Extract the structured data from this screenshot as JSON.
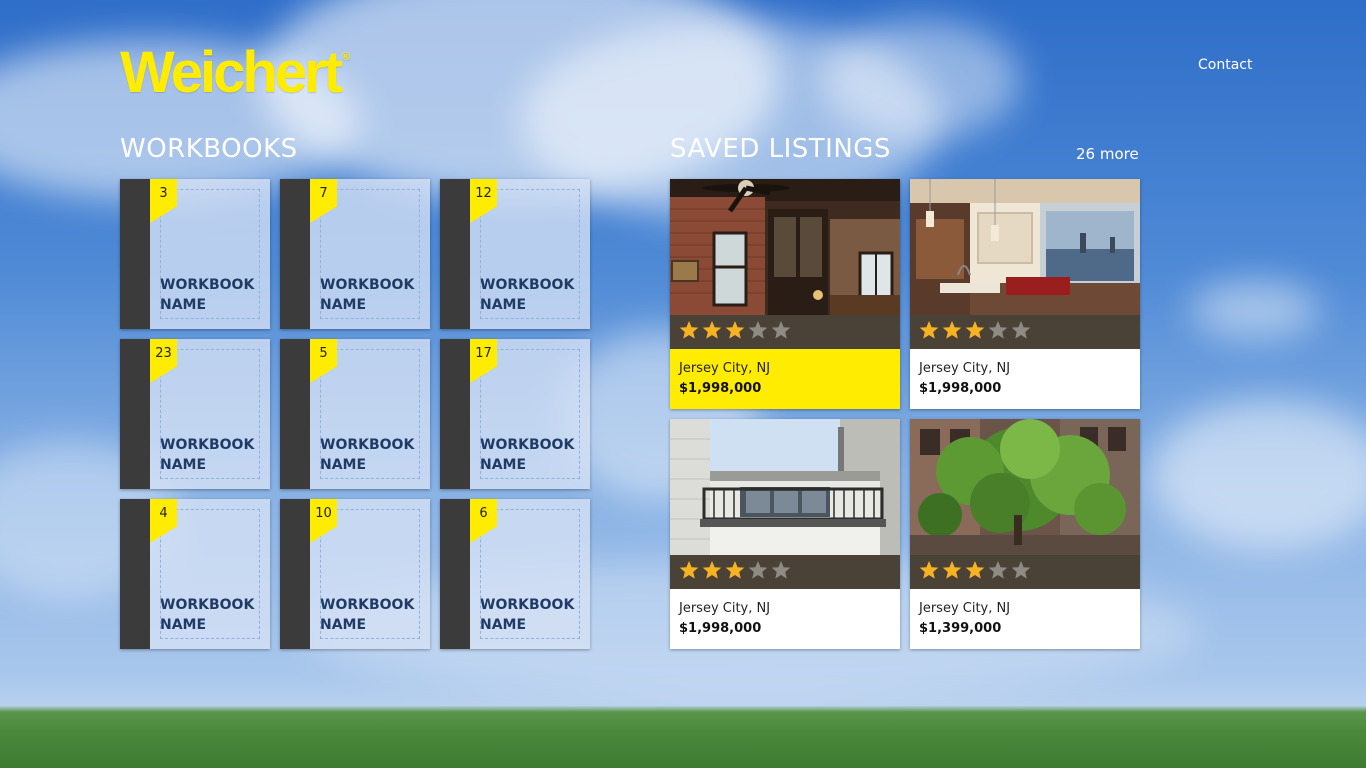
{
  "app": {
    "logo_text": "Weichert",
    "logo_mark": "®",
    "contact_label": "Contact"
  },
  "workbooks": {
    "title": "WORKBOOKS",
    "items": [
      {
        "count": "3",
        "name_line1": "WORKBOOK",
        "name_line2": "NAME"
      },
      {
        "count": "7",
        "name_line1": "WORKBOOK",
        "name_line2": "NAME"
      },
      {
        "count": "12",
        "name_line1": "WORKBOOK",
        "name_line2": "NAME"
      },
      {
        "count": "23",
        "name_line1": "WORKBOOK",
        "name_line2": "NAME"
      },
      {
        "count": "5",
        "name_line1": "WORKBOOK",
        "name_line2": "NAME"
      },
      {
        "count": "17",
        "name_line1": "WORKBOOK",
        "name_line2": "NAME"
      },
      {
        "count": "4",
        "name_line1": "WORKBOOK",
        "name_line2": "NAME"
      },
      {
        "count": "10",
        "name_line1": "WORKBOOK",
        "name_line2": "NAME"
      },
      {
        "count": "6",
        "name_line1": "WORKBOOK",
        "name_line2": "NAME"
      }
    ]
  },
  "saved_listings": {
    "title": "SAVED LISTINGS",
    "more_label": "26 more",
    "items": [
      {
        "city": "Jersey City, NJ",
        "price": "$1,998,000",
        "rating": 3,
        "max_rating": 5,
        "highlighted": true,
        "photo": "loft-interior-brick"
      },
      {
        "city": "Jersey City, NJ",
        "price": "$1,998,000",
        "rating": 3,
        "max_rating": 5,
        "highlighted": false,
        "photo": "open-kitchen-living"
      },
      {
        "city": "Jersey City, NJ",
        "price": "$1,998,000",
        "rating": 3,
        "max_rating": 5,
        "highlighted": false,
        "photo": "building-balcony"
      },
      {
        "city": "Jersey City, NJ",
        "price": "$1,399,000",
        "rating": 3,
        "max_rating": 5,
        "highlighted": false,
        "photo": "tree-lined-street"
      }
    ]
  },
  "colors": {
    "accent_yellow": "#ffec00",
    "star_filled": "#f5b323",
    "star_empty": "#8e8a84",
    "spine": "#3b3b3b",
    "rating_bar": "#4a4237"
  }
}
